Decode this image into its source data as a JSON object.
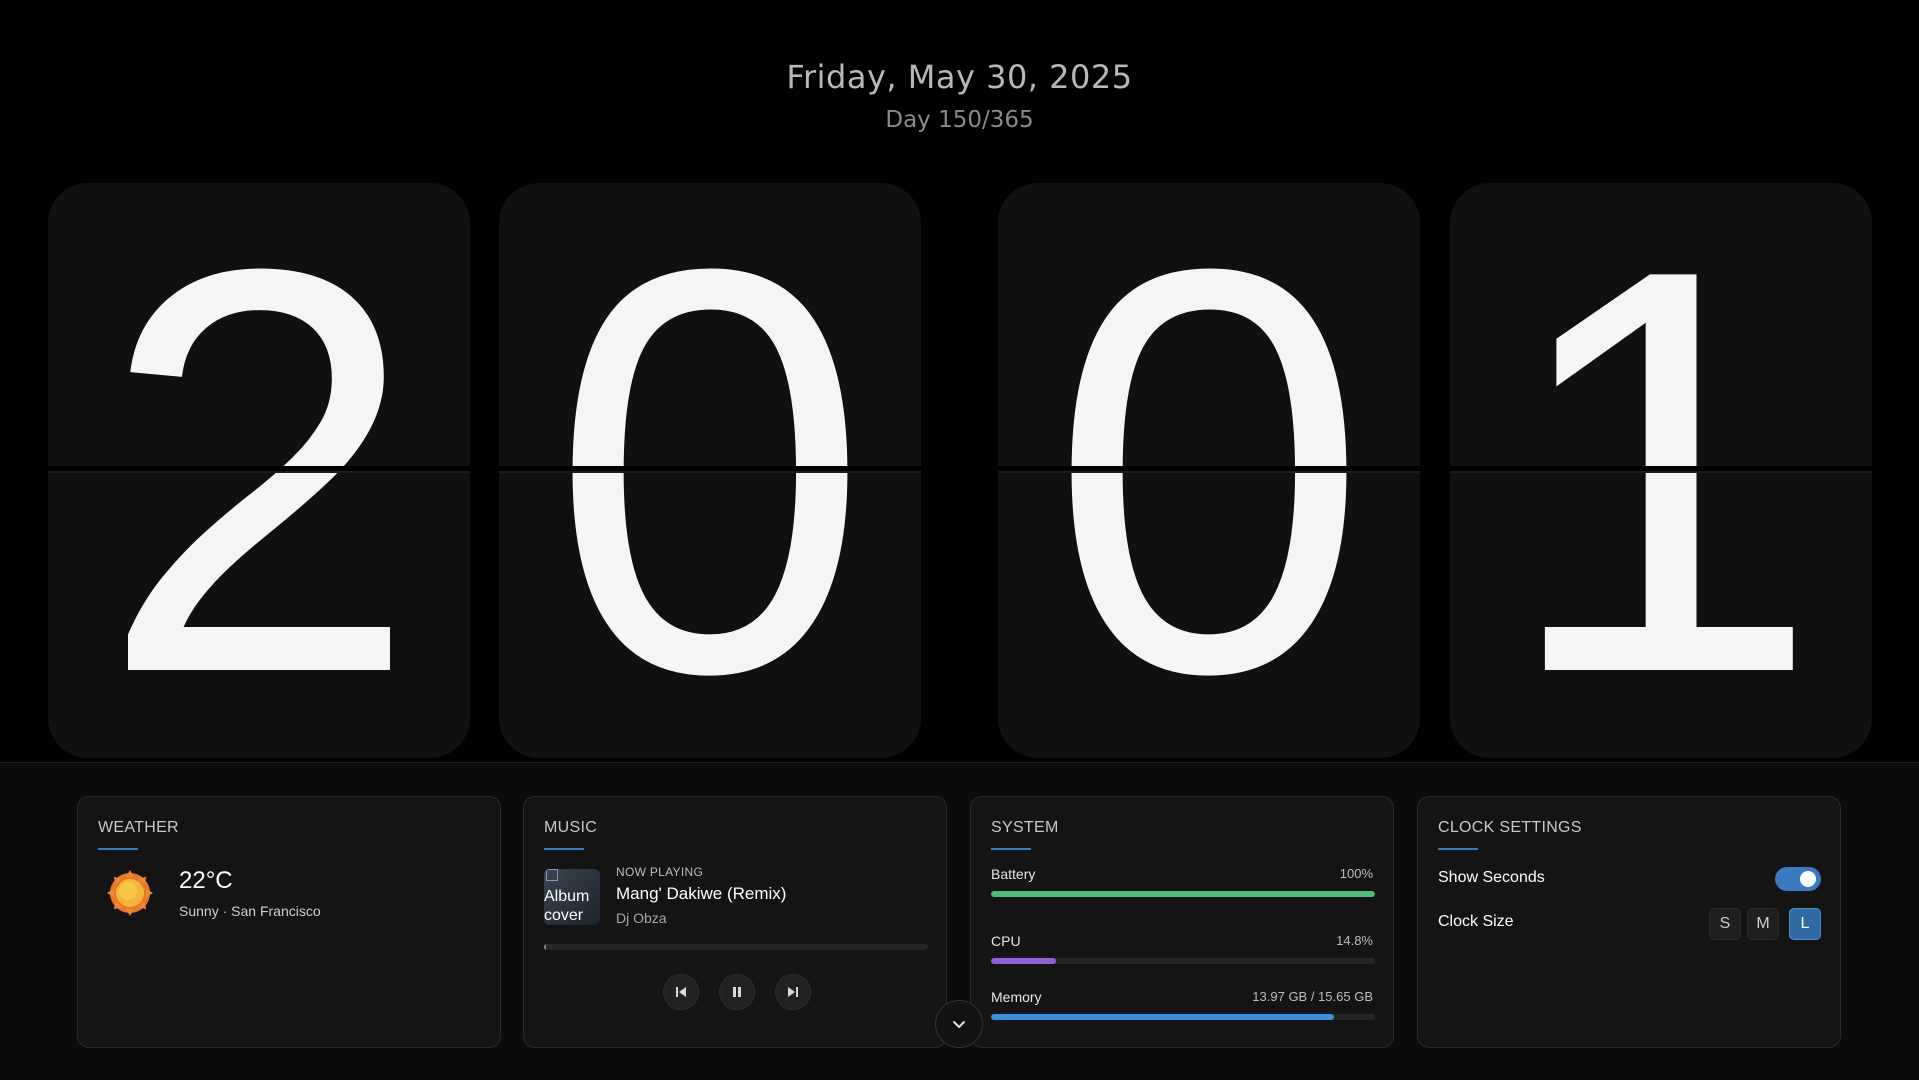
{
  "header": {
    "date": "Friday, May 30, 2025",
    "day_of_year": "Day 150/365"
  },
  "clock": {
    "digits": [
      "2",
      "0",
      "0",
      "1"
    ]
  },
  "weather": {
    "title": "WEATHER",
    "temperature": "22°C",
    "description": "Sunny · San Francisco",
    "icon": "sun-icon"
  },
  "music": {
    "title": "MUSIC",
    "now_playing_label": "NOW PLAYING",
    "track": "Mang' Dakiwe (Remix)",
    "artist": "Dj Obza",
    "album_alt": "Album cover",
    "progress": 0.005,
    "controls": [
      "previous-icon",
      "pause-icon",
      "next-icon"
    ]
  },
  "system": {
    "title": "SYSTEM",
    "battery": {
      "label": "Battery",
      "value": "100%",
      "fraction": 1.0,
      "color": "#4cbf7a"
    },
    "cpu": {
      "label": "CPU",
      "value": "14.8%",
      "fraction": 0.17,
      "color": "#8f62d6"
    },
    "memory": {
      "label": "Memory",
      "value": "13.97 GB / 15.65 GB",
      "fraction": 0.893,
      "color": "#3d8fde"
    }
  },
  "settings": {
    "title": "CLOCK SETTINGS",
    "show_seconds_label": "Show Seconds",
    "show_seconds": true,
    "clock_size_label": "Clock Size",
    "sizes": [
      "S",
      "M",
      "L"
    ],
    "selected_size": "L"
  },
  "colors": {
    "accent": "#3a7bc0",
    "background": "#000000",
    "card": "#101010"
  }
}
